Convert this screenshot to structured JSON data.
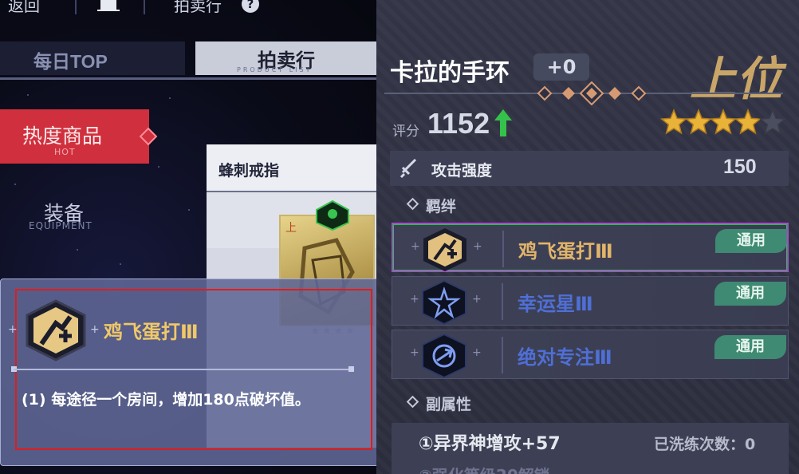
{
  "left_panel": {
    "topbar": {
      "back_label": "返回",
      "auction_label": "拍卖行",
      "help_icon": "question-icon",
      "home_icon": "home-icon"
    },
    "tabs": [
      {
        "label": "每日TOP"
      },
      {
        "label": "拍卖行",
        "sublabel": "PRODUCT LIST"
      }
    ],
    "categories": [
      {
        "label": "热度商品",
        "sublabel": "HOT",
        "active": true
      },
      {
        "label": "装备",
        "sublabel": "EQUIPMENT",
        "active": false
      }
    ],
    "product": {
      "name": "蜂刺戒指",
      "rank_mark": "上",
      "stars": "★★★★",
      "level_icon": "lvl-icon"
    }
  },
  "tooltip": {
    "skill_name": "鸡飞蛋打Ⅲ",
    "description": "(1) 每途径一个房间，增加180点破坏值。",
    "icon": "plus-one-hex-icon"
  },
  "right_panel": {
    "item_name": "卡拉的手环",
    "enhance": "+0",
    "rank": "上位",
    "score_label": "评分",
    "score": "1152",
    "score_trend": "up",
    "stars_filled": 4,
    "stars_total": 5,
    "attack": {
      "label": "攻击强度",
      "value": "150"
    },
    "bonds_title": "羁绊",
    "bonds": [
      {
        "name": "鸡飞蛋打Ⅲ",
        "badge": "通用",
        "color": "#e2b56a",
        "icon": "plus-one-hex-icon"
      },
      {
        "name": "幸运星Ⅲ",
        "badge": "通用",
        "color": "#4f6fd6",
        "icon": "star-hex-icon"
      },
      {
        "name": "绝对专注Ⅲ",
        "badge": "通用",
        "color": "#4f6fd6",
        "icon": "focus-hex-icon"
      }
    ],
    "sub_title": "副属性",
    "sub_attrs": [
      {
        "text": "①异界神增攻+57"
      },
      {
        "text": "②强化等级20解锁"
      }
    ],
    "wash_label": "已洗练次数：0"
  },
  "colors": {
    "accent_gold": "#c9a668",
    "hot_red": "#d0303d",
    "bond_badge": "#3f8a72"
  }
}
